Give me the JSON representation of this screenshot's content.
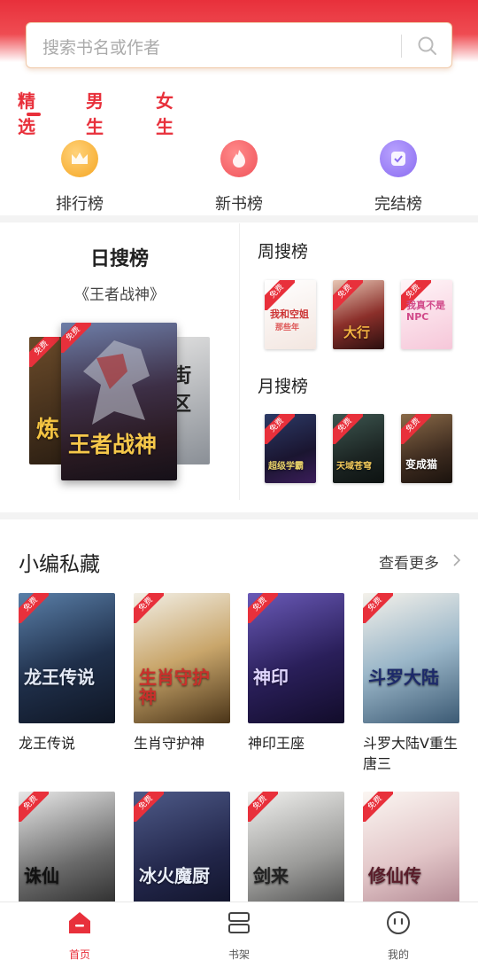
{
  "search": {
    "placeholder": "搜索书名或作者"
  },
  "tabs": [
    {
      "label": "精选"
    },
    {
      "label": "男生"
    },
    {
      "label": "女生"
    }
  ],
  "entries": [
    {
      "label": "排行榜"
    },
    {
      "label": "新书榜"
    },
    {
      "label": "完结榜"
    }
  ],
  "ranking": {
    "day": {
      "title": "日搜榜",
      "book": "《王者战神》",
      "cover_title": "王者战神",
      "side_cover_text": "街区"
    },
    "week": {
      "title": "周搜榜",
      "covers": [
        {
          "title": "我和空姐",
          "subtitle": "那些年"
        },
        {
          "title": "大行"
        },
        {
          "title": "我真不是NPC"
        }
      ]
    },
    "month": {
      "title": "月搜榜",
      "covers": [
        {
          "title": "超级学霸"
        },
        {
          "title": "天域苍穹"
        },
        {
          "title": "变成猫"
        }
      ]
    }
  },
  "badge": {
    "free": "免费"
  },
  "picks": {
    "title": "小编私藏",
    "more": "查看更多",
    "books": [
      {
        "title": "龙王传说"
      },
      {
        "title": "生肖守护神"
      },
      {
        "title": "神印王座"
      },
      {
        "title": "斗罗大陆V重生唐三"
      },
      {
        "title": ""
      },
      {
        "title": ""
      },
      {
        "title": ""
      },
      {
        "title": ""
      }
    ],
    "cover_texts": [
      "龙王传说",
      "生肖守护神",
      "神印",
      "斗罗大陆",
      "诛仙",
      "冰火魔厨",
      "剑来",
      "修仙传"
    ]
  },
  "nav": [
    {
      "label": "首页"
    },
    {
      "label": "书架"
    },
    {
      "label": "我的"
    }
  ],
  "colors": {
    "accent": "#e8303b",
    "crown": "#f5a623",
    "flame": "#f0535a",
    "check": "#8a6cf0"
  }
}
